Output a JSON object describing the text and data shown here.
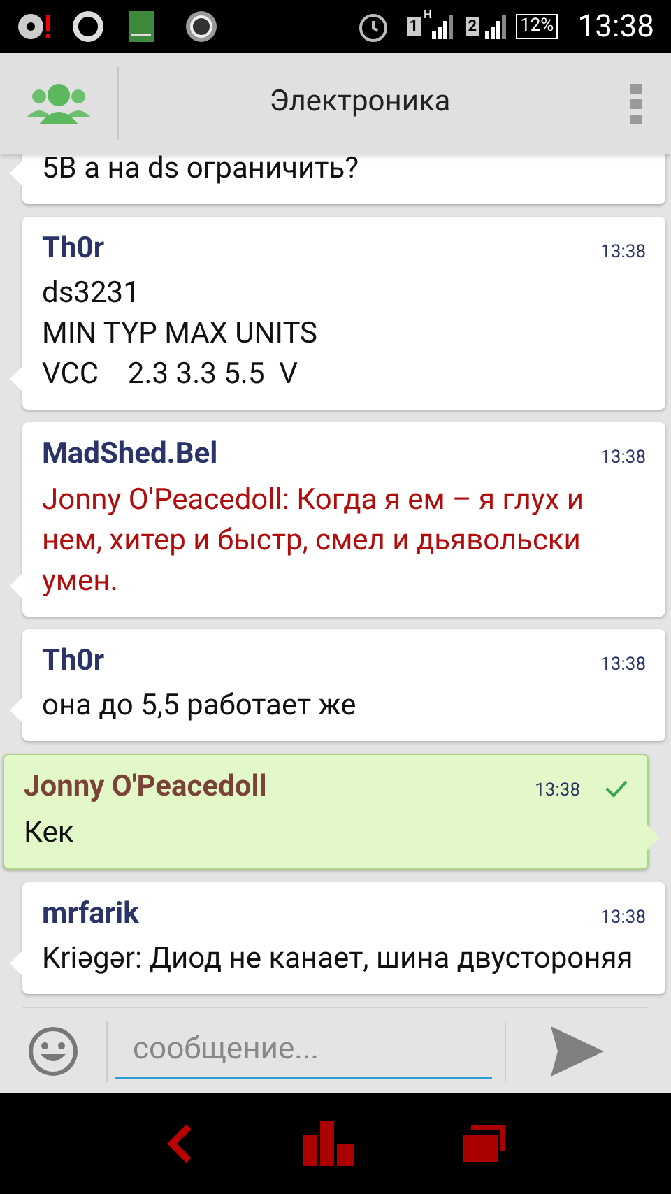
{
  "status_bar": {
    "sim_1": "1",
    "network": "H",
    "sim_2": "2",
    "battery": "12%",
    "time": "13:38"
  },
  "header": {
    "title": "Электроника"
  },
  "messages": [
    {
      "kind": "incoming",
      "text": "5В а на ds ограничить?",
      "highlighted": false
    },
    {
      "kind": "incoming",
      "author": "Th0r",
      "time": "13:38",
      "text": "ds3231\nMIN TYP MAX UNITS\nVCC    2.3 3.3 5.5  V",
      "highlighted": false
    },
    {
      "kind": "incoming",
      "author": "MadShed.Bel",
      "time": "13:38",
      "text": "Jonny O'Peacedoll: Когда я ем – я глух и нем, хитер и быстр, смел и дьявольски умен.",
      "highlighted": true
    },
    {
      "kind": "incoming",
      "author": "Th0r",
      "time": "13:38",
      "text": "она до 5,5 работает же",
      "highlighted": false
    },
    {
      "kind": "outgoing",
      "author": "Jonny O'Peacedoll",
      "time": "13:38",
      "text": "Кек",
      "highlighted": false,
      "delivered": true
    },
    {
      "kind": "incoming",
      "author": "mrfarik",
      "time": "13:38",
      "text": "Kriəgər: Диод не канает, шина двустороняя",
      "highlighted": false
    }
  ],
  "composer": {
    "placeholder": "сообщение..."
  }
}
